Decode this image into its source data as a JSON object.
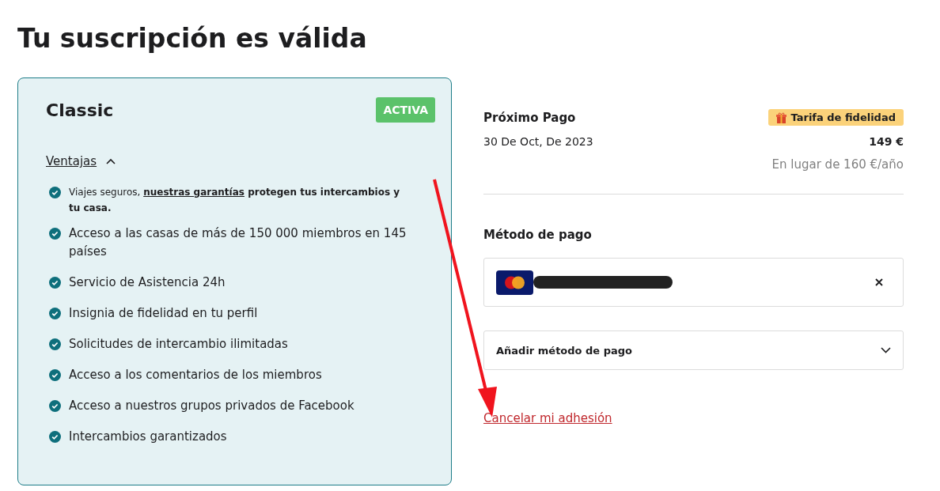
{
  "page_title": "Tu suscripción es válida",
  "plan": {
    "name": "Classic",
    "status": "ACTIVA",
    "benefits_toggle": {
      "label": "Ventajas",
      "expanded": true
    },
    "benefits": [
      {
        "kind": "rich",
        "before": "Viajes seguros, ",
        "link": "nuestras garantías",
        "after": " protegen tus intercambios y tu casa."
      },
      {
        "kind": "plain",
        "text": "Acceso a las casas de más de 150 000 miembros en 145 países"
      },
      {
        "kind": "plain",
        "text": "Servicio de Asistencia 24h"
      },
      {
        "kind": "plain",
        "text": "Insignia de fidelidad en tu perfil"
      },
      {
        "kind": "plain",
        "text": "Solicitudes de intercambio ilimitadas"
      },
      {
        "kind": "plain",
        "text": "Acceso a los comentarios de los miembros"
      },
      {
        "kind": "plain",
        "text": "Acceso a nuestros grupos privados de Facebook"
      },
      {
        "kind": "plain",
        "text": "Intercambios garantizados"
      }
    ]
  },
  "next_payment": {
    "label": "Próximo Pago",
    "badge": "Tarifa de fidelidad",
    "date": "30 De Oct, De 2023",
    "price": "149 €",
    "original_price": "En lugar de 160 €/año"
  },
  "payment_method": {
    "label": "Método de pago",
    "card": {
      "kind": "mastercard",
      "number_redacted": true
    },
    "add_label": "Añadir método de pago",
    "add_expanded": false
  },
  "cancel_link": "Cancelar mi adhesión"
}
